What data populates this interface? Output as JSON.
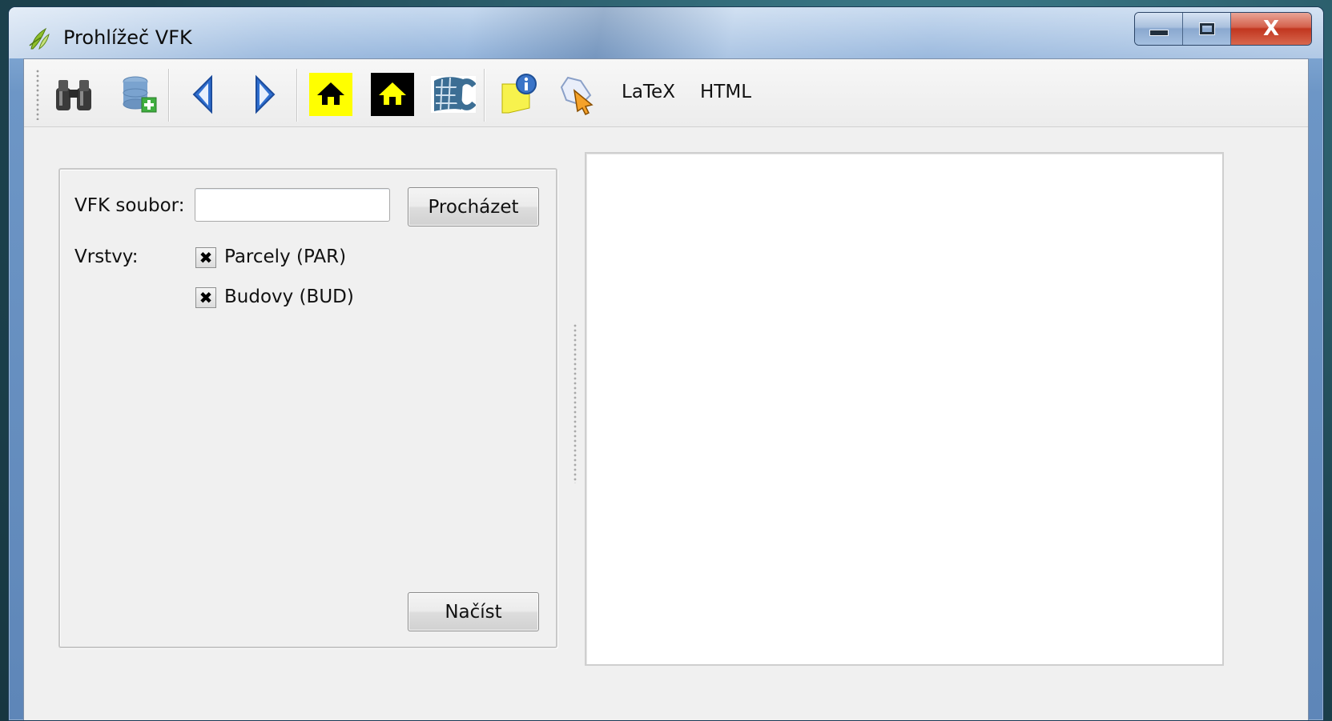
{
  "window": {
    "title": "Prohlížeč VFK",
    "app_icon": "qgis-leaf-icon",
    "controls": {
      "minimize_icon": "minimize-icon",
      "maximize_icon": "maximize-icon",
      "close_label": "X"
    }
  },
  "toolbar": {
    "buttons": [
      {
        "name": "search-binoculars",
        "icon": "binoculars-icon"
      },
      {
        "name": "add-database-layer",
        "icon": "database-add-icon"
      },
      {
        "name": "back",
        "icon": "arrow-left-icon"
      },
      {
        "name": "forward",
        "icon": "arrow-right-icon"
      },
      {
        "name": "home-yellow",
        "icon": "home-icon"
      },
      {
        "name": "home-black",
        "icon": "home-icon"
      },
      {
        "name": "cuzk",
        "icon": "cuzk-logo-icon"
      },
      {
        "name": "info-note",
        "icon": "info-note-icon"
      },
      {
        "name": "select-tool",
        "icon": "cursor-select-icon"
      }
    ],
    "latex_label": "LaTeX",
    "html_label": "HTML"
  },
  "form": {
    "vfk_label": "VFK soubor:",
    "vfk_value": "",
    "browse_label": "Procházet",
    "layers_label": "Vrstvy:",
    "layers": [
      {
        "label": "Parcely (PAR)",
        "checked": true
      },
      {
        "label": "Budovy (BUD)",
        "checked": true
      }
    ],
    "load_label": "Načíst"
  },
  "colors": {
    "highlight_yellow": "#ffff00",
    "arrow_blue": "#2f6fd0",
    "close_red": "#c8402a"
  }
}
